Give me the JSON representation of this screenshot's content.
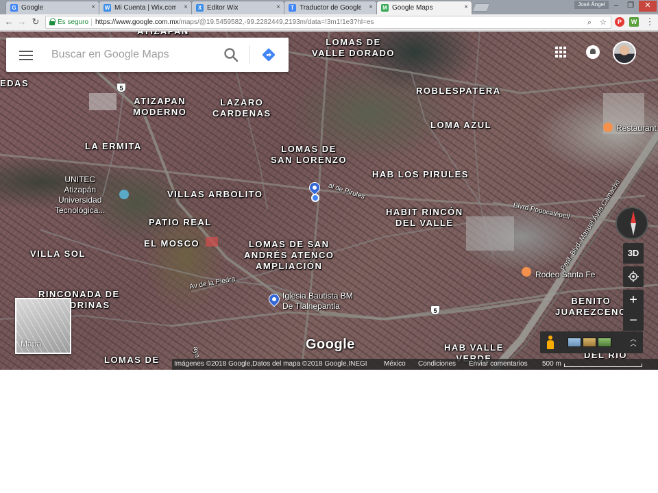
{
  "browser": {
    "tabs": [
      {
        "title": "Google",
        "favicon": "G",
        "favicon_color": "#4285f4",
        "active": false
      },
      {
        "title": "Mi Cuenta | Wix.com",
        "favicon": "W",
        "favicon_color": "#3b8ee8",
        "active": false
      },
      {
        "title": "Editor Wix",
        "favicon": "X",
        "favicon_color": "#3b8ee8",
        "active": false
      },
      {
        "title": "Traductor de Google",
        "favicon": "T",
        "favicon_color": "#4285f4",
        "active": false
      },
      {
        "title": "Google Maps",
        "favicon": "M",
        "favicon_color": "#34a853",
        "active": true
      }
    ],
    "user_name": "José Ángel",
    "close_glyph": "×",
    "secure_label": "Es seguro",
    "url_host": "https://www.google.com.mx",
    "url_path": "/maps/@19.5459582,-99.2282449,2193m/data=!3m1!1e3?hl=es",
    "icons": {
      "back": "arrow-left-icon",
      "forward": "arrow-right-icon",
      "reload": "reload-icon",
      "zoom": "magnifier-icon",
      "star": "star-icon",
      "menu": "kebab-menu-icon"
    }
  },
  "maps": {
    "search_placeholder": "Buscar en Google Maps",
    "places": [
      {
        "text": "ATIZAPAN"
      },
      {
        "text": "LOMAS DE\nVALLE DORADO"
      },
      {
        "text": "EDAS"
      },
      {
        "text": "ROBLESPATERA"
      },
      {
        "text": "ATIZAPAN\nMODERNO"
      },
      {
        "text": "LAZARO\nCARDENAS"
      },
      {
        "text": "LOMA AZUL"
      },
      {
        "text": "LA ERMITA"
      },
      {
        "text": "LOMAS DE\nSAN LORENZO"
      },
      {
        "text": "HAB LOS PIRULES"
      },
      {
        "text": "VILLAS ARBOLITO"
      },
      {
        "text": "HABIT RINCÓN\nDEL VALLE"
      },
      {
        "text": "PATIO REAL"
      },
      {
        "text": "EL MOSCO"
      },
      {
        "text": "LOMAS DE SAN\nANDRÉS ATENCO\nAMPLIACIÓN"
      },
      {
        "text": "VILLA SOL"
      },
      {
        "text": "RINCONADA DE\nLONDRINAS"
      },
      {
        "text": "BENITO\nJUAREZCENO"
      },
      {
        "text": "HAB VALLE\nVERDE"
      },
      {
        "text": "LOMAS DE"
      },
      {
        "text": "DEL RÍO"
      }
    ],
    "streets": [
      {
        "text": "al de Pirules"
      },
      {
        "text": "Blvrd Popocatépetl"
      },
      {
        "text": "Perif. Blvd. Manuel Ávila Camacho"
      },
      {
        "text": "Av de la Piedra"
      },
      {
        "text": "aya"
      }
    ],
    "pois": [
      {
        "text": "UNITEC\nAtizapán\nUniversidad\nTecnológica..."
      },
      {
        "text": "Iglesia Bautista BM\nDe Tlalnepantla"
      },
      {
        "text": "Rodeo Santa Fe"
      },
      {
        "text": "Restaurant"
      }
    ],
    "route_badges": [
      "5",
      "5"
    ],
    "minimap_label": "Mapa",
    "logo": "Google",
    "controls": {
      "tilt_label": "3D",
      "zoom_in": "+",
      "zoom_out": "−",
      "expand": "⌃"
    },
    "footer": {
      "imagery": "Imágenes ©2018 Google,Datos del mapa ©2018 Google,INEGI",
      "country": "México",
      "terms": "Condiciones",
      "feedback": "Enviar comentarios",
      "scale": "500 m"
    },
    "colors": {
      "accent": "#4285f4",
      "pin": "#3367d6",
      "restaurant": "#f4914d"
    }
  }
}
